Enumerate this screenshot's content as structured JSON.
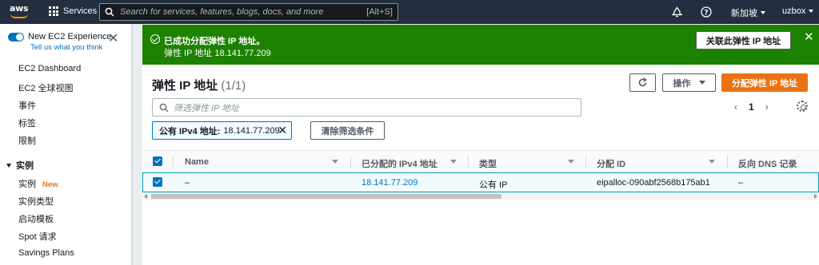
{
  "topnav": {
    "logo_text": "aws",
    "services_label": "Services",
    "search_placeholder": "Search for services, features, blogs, docs, and more",
    "search_shortcut": "[Alt+S]",
    "region": "新加坡",
    "user": "uzbox",
    "icons": [
      "bell-icon",
      "help-icon",
      "grid-icon",
      "search-icon"
    ]
  },
  "sidebar": {
    "new_experience": "New EC2 Experience",
    "tell_us": "Tell us what you think",
    "items": [
      "EC2 Dashboard",
      "EC2 全球视图",
      "事件",
      "标签",
      "限制"
    ],
    "group": "实例",
    "group_items": [
      {
        "label": "实例",
        "badge": "New"
      },
      {
        "label": "实例类型",
        "badge": ""
      },
      {
        "label": "启动模板",
        "badge": ""
      },
      {
        "label": "Spot 请求",
        "badge": ""
      },
      {
        "label": "Savings Plans",
        "badge": ""
      }
    ]
  },
  "flash": {
    "title": "已成功分配弹性 IP 地址。",
    "subtitle": "弹性 IP 地址 18.141.77.209",
    "action_label": "关联此弹性 IP 地址",
    "color": "#1d8102"
  },
  "panel": {
    "title": "弹性 IP 地址",
    "count": "(1/1)",
    "actions_label": "操作",
    "allocate_label": "分配弹性 IP 地址",
    "filter_placeholder": "筛选弹性 IP 地址",
    "page_number": "1",
    "token_key": "公有 IPv4 地址:",
    "token_value": "18.141.77.209",
    "clear_filters_label": "清除筛选条件",
    "accent_color": "#ec7211"
  },
  "table": {
    "columns": [
      "Name",
      "已分配的 IPv4 地址",
      "类型",
      "分配 ID",
      "反向 DNS 记录"
    ],
    "rows": [
      {
        "name": "–",
        "ipv4": "18.141.77.209",
        "type": "公有 IP",
        "allocation_id": "eipalloc-090abf2568b175ab1",
        "reverse_dns": "–",
        "selected": true
      }
    ]
  }
}
